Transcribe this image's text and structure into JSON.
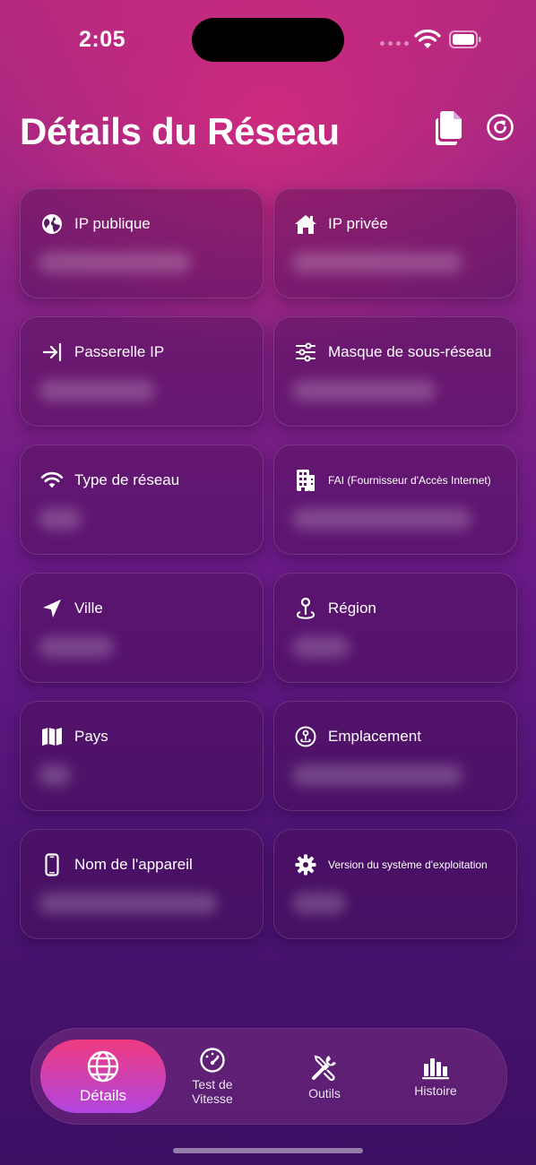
{
  "status_bar": {
    "time": "2:05"
  },
  "header": {
    "title": "Détails du Réseau"
  },
  "cards": [
    {
      "icon": "globe-icon",
      "label": "IP publique",
      "value": ""
    },
    {
      "icon": "house-icon",
      "label": "IP privée",
      "value": ""
    },
    {
      "icon": "arrow-to-line-icon",
      "label": "Passerelle IP",
      "value": ""
    },
    {
      "icon": "sliders-icon",
      "label": "Masque de sous-réseau",
      "value": ""
    },
    {
      "icon": "wifi-icon",
      "label": "Type de réseau",
      "value": ""
    },
    {
      "icon": "building-icon",
      "label": "FAI (Fournisseur d'Accès Internet)",
      "value": ""
    },
    {
      "icon": "location-arrow-icon",
      "label": "Ville",
      "value": ""
    },
    {
      "icon": "map-pin-icon",
      "label": "Région",
      "value": ""
    },
    {
      "icon": "map-icon",
      "label": "Pays",
      "value": ""
    },
    {
      "icon": "location-circle-icon",
      "label": "Emplacement",
      "value": ""
    },
    {
      "icon": "iphone-icon",
      "label": "Nom de l'appareil",
      "value": ""
    },
    {
      "icon": "gear-icon",
      "label": "Version du système d'exploitation",
      "value": ""
    }
  ],
  "tabs": [
    {
      "icon": "globe-icon",
      "label": "Détails",
      "active": true
    },
    {
      "icon": "speedometer-icon",
      "label": "Test de Vitesse",
      "active": false
    },
    {
      "icon": "tools-icon",
      "label": "Outils",
      "active": false
    },
    {
      "icon": "bar-chart-icon",
      "label": "Histoire",
      "active": false
    }
  ]
}
